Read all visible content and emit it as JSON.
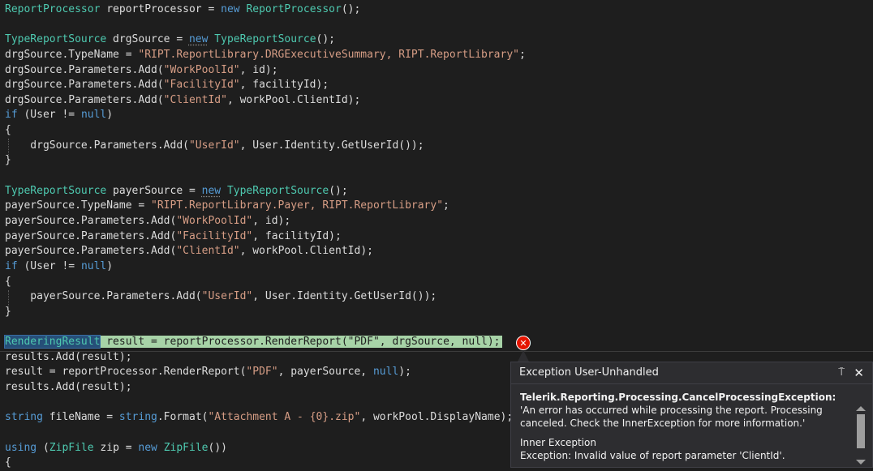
{
  "code": {
    "l1": {
      "t1": "ReportProcessor",
      "p1": " reportProcessor = ",
      "k1": "new",
      "p2": " ",
      "t2": "ReportProcessor",
      "p3": "();"
    },
    "l3": {
      "t1": "TypeReportSource",
      "p1": " drgSource = ",
      "k1": "new",
      "p2": " ",
      "t2": "TypeReportSource",
      "p3": "();"
    },
    "l4": {
      "p1": "drgSource.TypeName = ",
      "s1": "\"RIPT.ReportLibrary.DRGExecutiveSummary, RIPT.ReportLibrary\"",
      "p2": ";"
    },
    "l5": {
      "p1": "drgSource.Parameters.Add(",
      "s1": "\"WorkPoolId\"",
      "p2": ", id);"
    },
    "l6": {
      "p1": "drgSource.Parameters.Add(",
      "s1": "\"FacilityId\"",
      "p2": ", facilityId);"
    },
    "l7": {
      "p1": "drgSource.Parameters.Add(",
      "s1": "\"ClientId\"",
      "p2": ", workPool.ClientId);"
    },
    "l8": {
      "k1": "if",
      "p1": " (User != ",
      "k2": "null",
      "p2": ")"
    },
    "l9": {
      "p1": "{"
    },
    "l10": {
      "p1": "    drgSource.Parameters.Add(",
      "s1": "\"UserId\"",
      "p2": ", User.Identity.GetUserId());"
    },
    "l11": {
      "p1": "}"
    },
    "l13": {
      "t1": "TypeReportSource",
      "p1": " payerSource = ",
      "k1": "new",
      "p2": " ",
      "t2": "TypeReportSource",
      "p3": "();"
    },
    "l14": {
      "p1": "payerSource.TypeName = ",
      "s1": "\"RIPT.ReportLibrary.Payer, RIPT.ReportLibrary\"",
      "p2": ";"
    },
    "l15": {
      "p1": "payerSource.Parameters.Add(",
      "s1": "\"WorkPoolId\"",
      "p2": ", id);"
    },
    "l16": {
      "p1": "payerSource.Parameters.Add(",
      "s1": "\"FacilityId\"",
      "p2": ", facilityId);"
    },
    "l17": {
      "p1": "payerSource.Parameters.Add(",
      "s1": "\"ClientId\"",
      "p2": ", workPool.ClientId);"
    },
    "l18": {
      "k1": "if",
      "p1": " (User != ",
      "k2": "null",
      "p2": ")"
    },
    "l19": {
      "p1": "{"
    },
    "l20": {
      "p1": "    payerSource.Parameters.Add(",
      "s1": "\"UserId\"",
      "p2": ", User.Identity.GetUserId());"
    },
    "l21": {
      "p1": "}"
    },
    "l23": {
      "t1": "RenderingResult",
      "p1": " result = reportProcessor.RenderReport(",
      "s1": "\"PDF\"",
      "p2": ", drgSource, null);"
    },
    "l24": {
      "p1": "results.Add(result);"
    },
    "l25": {
      "p1": "result = reportProcessor.RenderReport(",
      "s1": "\"PDF\"",
      "p2": ", payerSource, ",
      "k1": "null",
      "p3": ");"
    },
    "l26": {
      "p1": "results.Add(result);"
    },
    "l28": {
      "k1": "string",
      "p1": " fileName = ",
      "k2": "string",
      "p2": ".Format(",
      "s1": "\"Attachment A - {0}.zip\"",
      "p3": ", workPool.DisplayName);"
    },
    "l30": {
      "k1": "using",
      "p1": " (",
      "t1": "ZipFile",
      "p2": " zip = ",
      "k2": "new",
      "p3": " ",
      "t2": "ZipFile",
      "p4": "())"
    },
    "l31": {
      "p1": "{"
    }
  },
  "exception": {
    "title": "Exception User-Unhandled",
    "pin_glyph": "⍑",
    "close_glyph": "✕",
    "type": "Telerik.Reporting.Processing.CancelProcessingException:",
    "message": " 'An error has occurred while processing the report. Processing canceled. Check the InnerException for more information.'",
    "inner_title": "Inner Exception",
    "inner_message": "Exception: Invalid value of report parameter 'ClientId'."
  },
  "colors": {
    "type": "#4ec9b0",
    "keyword": "#569cd6",
    "string": "#d69d85",
    "error": "#e51400",
    "highlight": "#a7d3a7"
  }
}
